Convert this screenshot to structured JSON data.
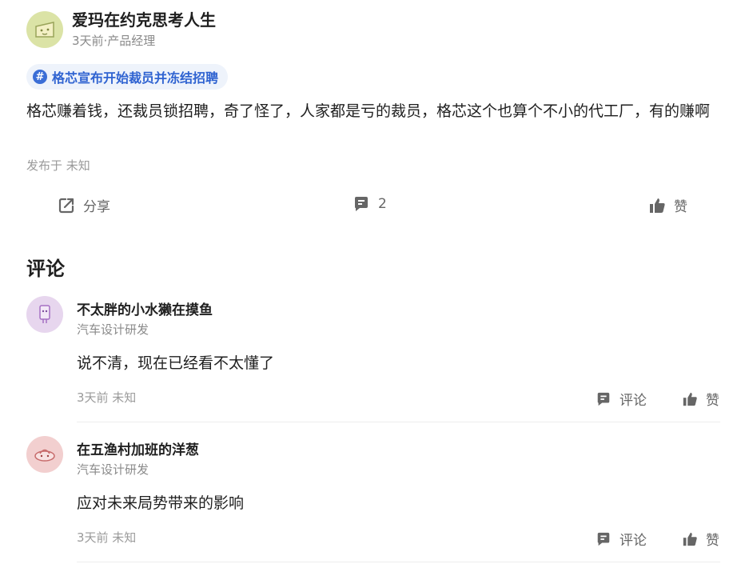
{
  "post": {
    "author": "爱玛在约克思考人生",
    "meta": "3天前·产品经理",
    "topic": "格芯宣布开始裁员并冻结招聘",
    "content": "格芯赚着钱，还裁员锁招聘，奇了怪了，人家都是亏的裁员，格芯这个也算个不小的代工厂，有的赚啊",
    "published": "发布于 未知",
    "actions": {
      "share_label": "分享",
      "comment_count": "2",
      "like_label": "赞"
    }
  },
  "comments_section": {
    "title": "评论",
    "comments": [
      {
        "name": "不太胖的小水獭在摸鱼",
        "role": "汽车设计研发",
        "text": "说不清，现在已经看不太懂了",
        "time": "3天前 未知",
        "comment_label": "评论",
        "like_label": "赞"
      },
      {
        "name": "在五渔村加班的洋葱",
        "role": "汽车设计研发",
        "text": "应对未来局势带来的影响",
        "time": "3天前 未知",
        "comment_label": "评论",
        "like_label": "赞"
      }
    ]
  },
  "colors": {
    "accent": "#2f63d1",
    "chip_bg": "#eef3fb",
    "icon_gray": "#666666"
  }
}
